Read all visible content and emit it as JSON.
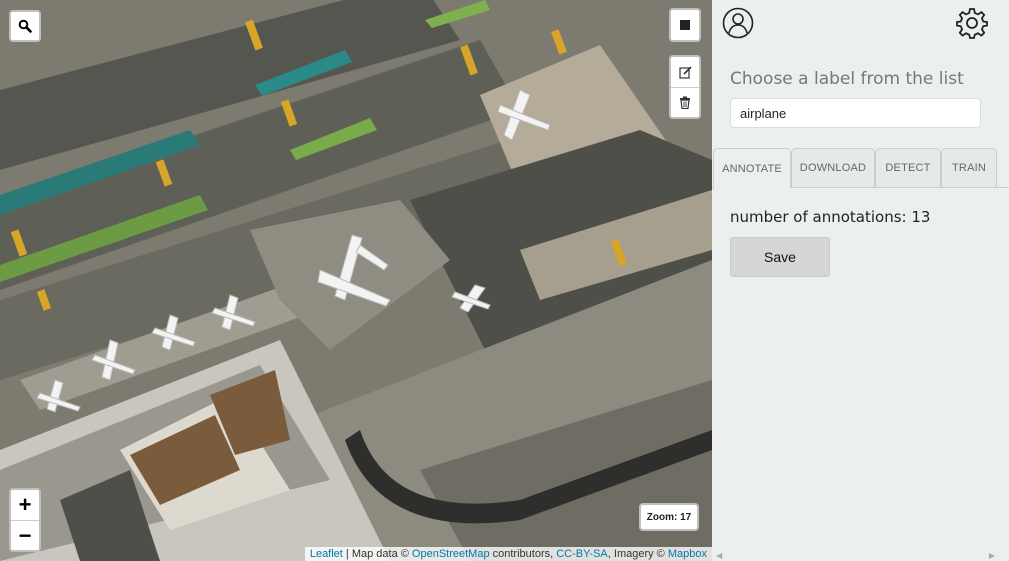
{
  "map": {
    "search_icon": "search-icon",
    "draw_rectangle_icon": "square-icon",
    "edit_icon": "edit-icon",
    "delete_icon": "trash-icon",
    "zoom_in_label": "+",
    "zoom_out_label": "−",
    "zoom_display": "Zoom: 17",
    "attribution": {
      "leaflet": "Leaflet",
      "sep1": " | Map data © ",
      "osm": "OpenStreetMap",
      "contributors": " contributors, ",
      "license": "CC-BY-SA",
      "imagery": ", Imagery © ",
      "mapbox": "Mapbox"
    }
  },
  "sidebar": {
    "user_icon": "user-icon",
    "settings_icon": "gear-icon",
    "label_heading": "Choose a label from the list",
    "label_value": "airplane",
    "tabs": [
      {
        "label": "ANNOTATE",
        "active": true
      },
      {
        "label": "DOWNLOAD",
        "active": false
      },
      {
        "label": "DETECT",
        "active": false
      },
      {
        "label": "TRAIN",
        "active": false
      }
    ],
    "annotation_count": "number of annotations: 13",
    "save_label": "Save"
  },
  "colors": {
    "link": "#0078a8",
    "sidebar_bg": "#eceff0",
    "save_bg": "#d6d6d6"
  }
}
